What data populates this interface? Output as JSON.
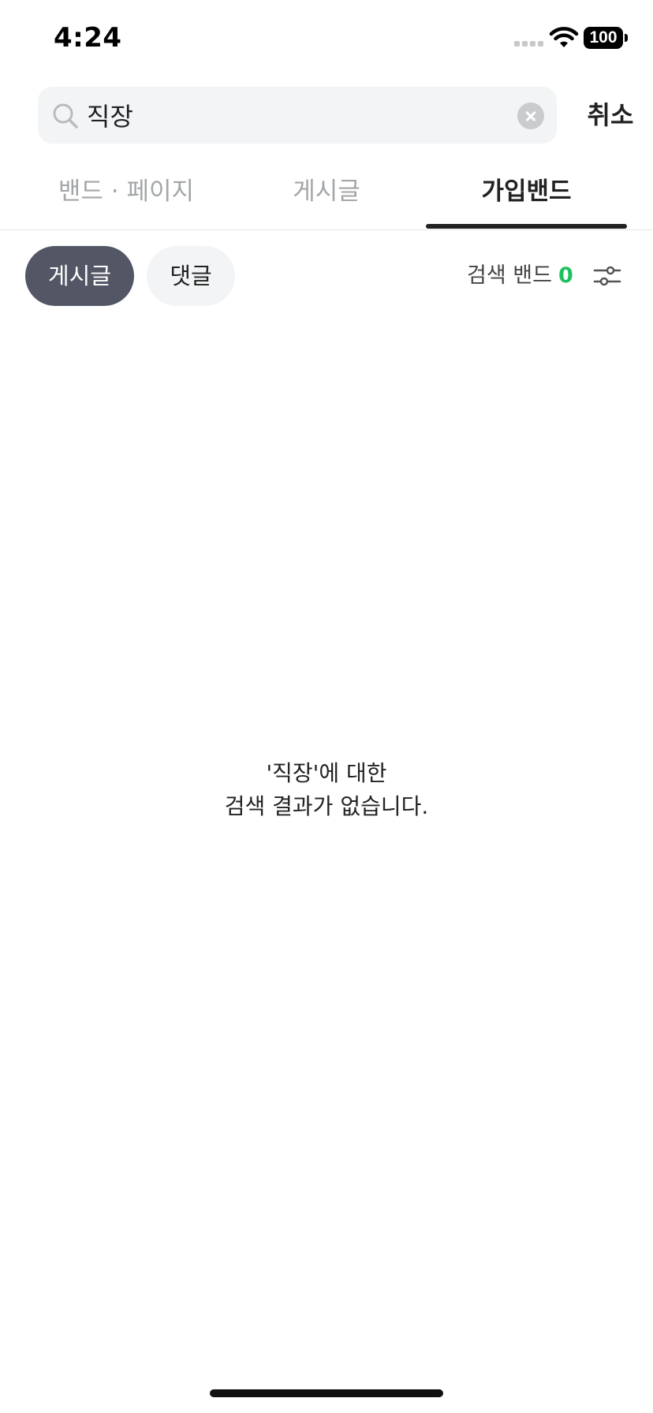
{
  "status_bar": {
    "time": "4:24",
    "battery": "100"
  },
  "search": {
    "query": "직장",
    "cancel_label": "취소"
  },
  "tabs": [
    {
      "label": "밴드 · 페이지",
      "active": false
    },
    {
      "label": "게시글",
      "active": false
    },
    {
      "label": "가입밴드",
      "active": true
    }
  ],
  "chips": [
    {
      "label": "게시글",
      "selected": true
    },
    {
      "label": "댓글",
      "selected": false
    }
  ],
  "band_filter": {
    "label": "검색 밴드",
    "count": "0",
    "count_color": "#1ec15f"
  },
  "empty_state": {
    "line1": "'직장'에 대한",
    "line2": "검색 결과가 없습니다."
  },
  "icons": {
    "search": "search-icon",
    "clear": "clear-icon",
    "filter": "filter-sliders-icon",
    "wifi": "wifi-icon"
  },
  "colors": {
    "selected_chip": "#535665",
    "accent_count": "#1ec15f",
    "search_bg": "#f2f4f5"
  }
}
